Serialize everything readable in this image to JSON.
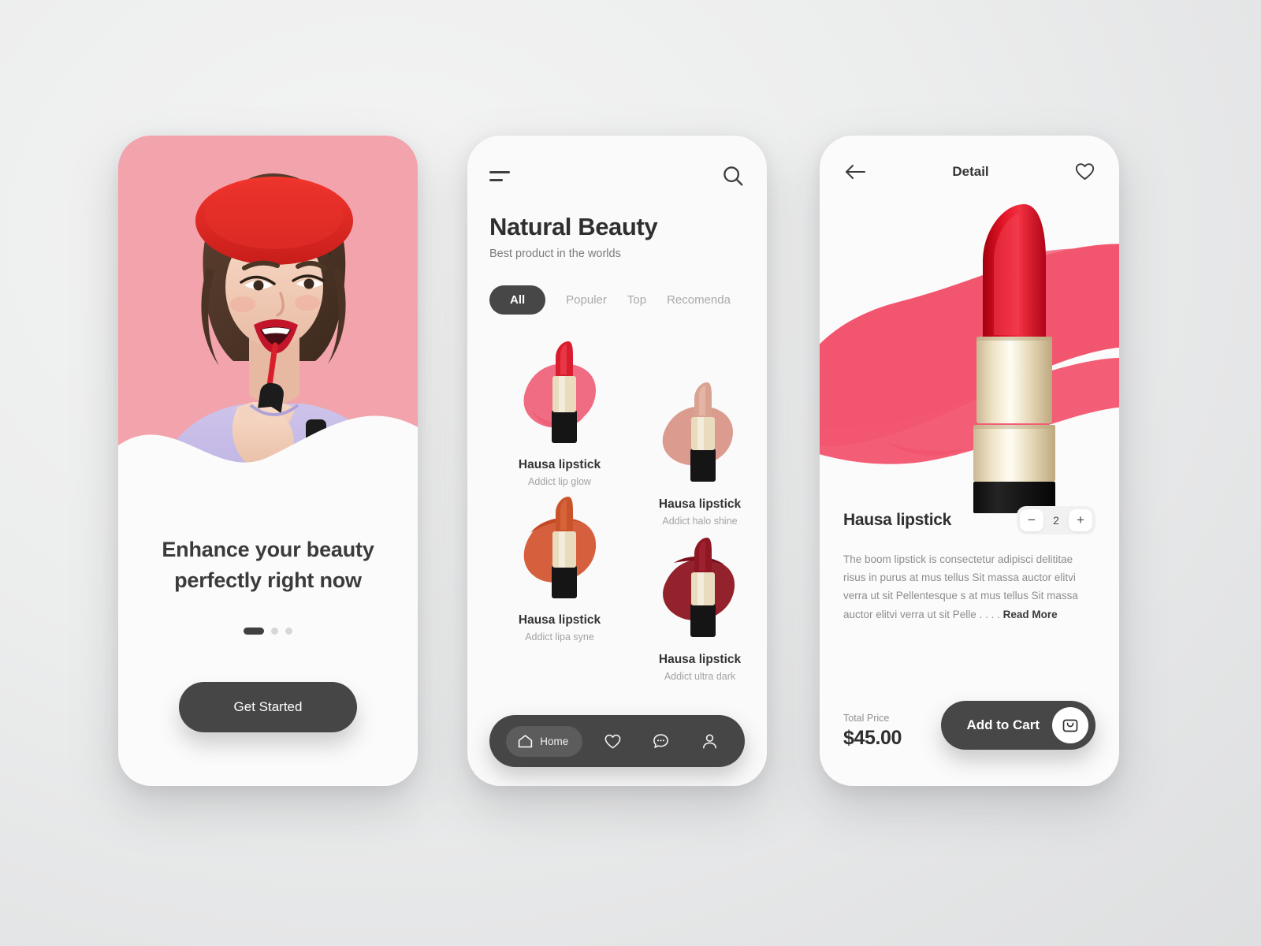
{
  "theme": {
    "dark": "#464646",
    "pink": "#f2566f",
    "hero_pink": "#f3a3ac",
    "muted": "#a3a3a3"
  },
  "screen1": {
    "name": "onboarding",
    "headline_line1": "Enhance your beauty",
    "headline_line2": "perfectly right now",
    "dots": [
      {
        "active": true
      },
      {
        "active": false
      },
      {
        "active": false
      }
    ],
    "cta_label": "Get Started",
    "hero_alt": "woman-applying-red-lipstick"
  },
  "screen2": {
    "name": "home",
    "menu_icon": "hamburger-icon",
    "search_icon": "search-icon",
    "title": "Natural Beauty",
    "subtitle": "Best product in the worlds",
    "tabs": [
      {
        "label": "All",
        "active": true
      },
      {
        "label": "Populer",
        "active": false
      },
      {
        "label": "Top",
        "active": false
      },
      {
        "label": "Recomenda",
        "active": false
      }
    ],
    "products": [
      {
        "name": "Hausa lipstick",
        "desc": "Addict lip glow",
        "swatch": "#ee5f78",
        "tip": "#d81e2e",
        "barrel": "#e9dcbe",
        "base": "#151515"
      },
      {
        "name": "Hausa lipstick",
        "desc": "Addict halo shine",
        "swatch": "#d79183",
        "tip": "#d9a392",
        "barrel": "#e9dcbe",
        "base": "#151515"
      },
      {
        "name": "Hausa lipstick",
        "desc": "Addict lipa syne",
        "swatch": "#d2532c",
        "tip": "#c9542c",
        "barrel": "#e9dcbe",
        "base": "#151515"
      },
      {
        "name": "Hausa lipstick",
        "desc": "Addict ultra dark",
        "swatch": "#8c1420",
        "tip": "#8e1724",
        "barrel": "#e9dcbe",
        "base": "#151515"
      }
    ],
    "nav": [
      {
        "icon": "home-icon",
        "label": "Home",
        "active": true
      },
      {
        "icon": "heart-icon",
        "label": "",
        "active": false
      },
      {
        "icon": "chat-icon",
        "label": "",
        "active": false
      },
      {
        "icon": "person-icon",
        "label": "",
        "active": false
      }
    ]
  },
  "screen3": {
    "name": "detail",
    "back_icon": "arrow-left-icon",
    "title": "Detail",
    "favorite_icon": "heart-icon",
    "product_name": "Hausa lipstick",
    "quantity": "2",
    "minus_label": "−",
    "plus_label": "+",
    "description": "The boom lipstick is consectetur adipisci delititae risus in purus at mus tellus Sit massa auctor elitvi verra ut sit Pellentesque s at mus tellus Sit massa auctor elitvi verra ut sit Pelle . . . .",
    "read_more": "Read More",
    "total_price_label": "Total Price",
    "total_price_value": "$45.00",
    "add_to_cart_label": "Add to Cart",
    "bag_icon": "shopping-bag-icon"
  }
}
